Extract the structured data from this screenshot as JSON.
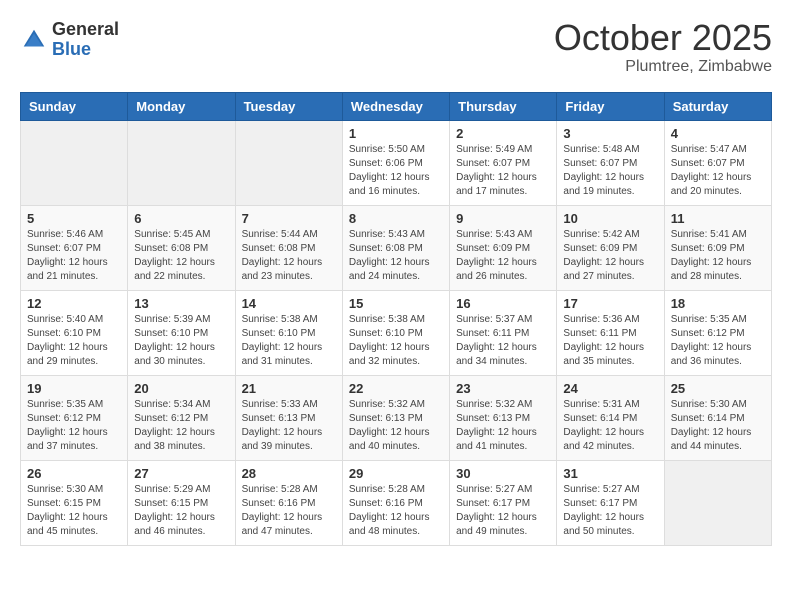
{
  "header": {
    "logo_general": "General",
    "logo_blue": "Blue",
    "month": "October 2025",
    "location": "Plumtree, Zimbabwe"
  },
  "days_of_week": [
    "Sunday",
    "Monday",
    "Tuesday",
    "Wednesday",
    "Thursday",
    "Friday",
    "Saturday"
  ],
  "weeks": [
    [
      {
        "day": "",
        "content": ""
      },
      {
        "day": "",
        "content": ""
      },
      {
        "day": "",
        "content": ""
      },
      {
        "day": "1",
        "content": "Sunrise: 5:50 AM\nSunset: 6:06 PM\nDaylight: 12 hours and 16 minutes."
      },
      {
        "day": "2",
        "content": "Sunrise: 5:49 AM\nSunset: 6:07 PM\nDaylight: 12 hours and 17 minutes."
      },
      {
        "day": "3",
        "content": "Sunrise: 5:48 AM\nSunset: 6:07 PM\nDaylight: 12 hours and 19 minutes."
      },
      {
        "day": "4",
        "content": "Sunrise: 5:47 AM\nSunset: 6:07 PM\nDaylight: 12 hours and 20 minutes."
      }
    ],
    [
      {
        "day": "5",
        "content": "Sunrise: 5:46 AM\nSunset: 6:07 PM\nDaylight: 12 hours and 21 minutes."
      },
      {
        "day": "6",
        "content": "Sunrise: 5:45 AM\nSunset: 6:08 PM\nDaylight: 12 hours and 22 minutes."
      },
      {
        "day": "7",
        "content": "Sunrise: 5:44 AM\nSunset: 6:08 PM\nDaylight: 12 hours and 23 minutes."
      },
      {
        "day": "8",
        "content": "Sunrise: 5:43 AM\nSunset: 6:08 PM\nDaylight: 12 hours and 24 minutes."
      },
      {
        "day": "9",
        "content": "Sunrise: 5:43 AM\nSunset: 6:09 PM\nDaylight: 12 hours and 26 minutes."
      },
      {
        "day": "10",
        "content": "Sunrise: 5:42 AM\nSunset: 6:09 PM\nDaylight: 12 hours and 27 minutes."
      },
      {
        "day": "11",
        "content": "Sunrise: 5:41 AM\nSunset: 6:09 PM\nDaylight: 12 hours and 28 minutes."
      }
    ],
    [
      {
        "day": "12",
        "content": "Sunrise: 5:40 AM\nSunset: 6:10 PM\nDaylight: 12 hours and 29 minutes."
      },
      {
        "day": "13",
        "content": "Sunrise: 5:39 AM\nSunset: 6:10 PM\nDaylight: 12 hours and 30 minutes."
      },
      {
        "day": "14",
        "content": "Sunrise: 5:38 AM\nSunset: 6:10 PM\nDaylight: 12 hours and 31 minutes."
      },
      {
        "day": "15",
        "content": "Sunrise: 5:38 AM\nSunset: 6:10 PM\nDaylight: 12 hours and 32 minutes."
      },
      {
        "day": "16",
        "content": "Sunrise: 5:37 AM\nSunset: 6:11 PM\nDaylight: 12 hours and 34 minutes."
      },
      {
        "day": "17",
        "content": "Sunrise: 5:36 AM\nSunset: 6:11 PM\nDaylight: 12 hours and 35 minutes."
      },
      {
        "day": "18",
        "content": "Sunrise: 5:35 AM\nSunset: 6:12 PM\nDaylight: 12 hours and 36 minutes."
      }
    ],
    [
      {
        "day": "19",
        "content": "Sunrise: 5:35 AM\nSunset: 6:12 PM\nDaylight: 12 hours and 37 minutes."
      },
      {
        "day": "20",
        "content": "Sunrise: 5:34 AM\nSunset: 6:12 PM\nDaylight: 12 hours and 38 minutes."
      },
      {
        "day": "21",
        "content": "Sunrise: 5:33 AM\nSunset: 6:13 PM\nDaylight: 12 hours and 39 minutes."
      },
      {
        "day": "22",
        "content": "Sunrise: 5:32 AM\nSunset: 6:13 PM\nDaylight: 12 hours and 40 minutes."
      },
      {
        "day": "23",
        "content": "Sunrise: 5:32 AM\nSunset: 6:13 PM\nDaylight: 12 hours and 41 minutes."
      },
      {
        "day": "24",
        "content": "Sunrise: 5:31 AM\nSunset: 6:14 PM\nDaylight: 12 hours and 42 minutes."
      },
      {
        "day": "25",
        "content": "Sunrise: 5:30 AM\nSunset: 6:14 PM\nDaylight: 12 hours and 44 minutes."
      }
    ],
    [
      {
        "day": "26",
        "content": "Sunrise: 5:30 AM\nSunset: 6:15 PM\nDaylight: 12 hours and 45 minutes."
      },
      {
        "day": "27",
        "content": "Sunrise: 5:29 AM\nSunset: 6:15 PM\nDaylight: 12 hours and 46 minutes."
      },
      {
        "day": "28",
        "content": "Sunrise: 5:28 AM\nSunset: 6:16 PM\nDaylight: 12 hours and 47 minutes."
      },
      {
        "day": "29",
        "content": "Sunrise: 5:28 AM\nSunset: 6:16 PM\nDaylight: 12 hours and 48 minutes."
      },
      {
        "day": "30",
        "content": "Sunrise: 5:27 AM\nSunset: 6:17 PM\nDaylight: 12 hours and 49 minutes."
      },
      {
        "day": "31",
        "content": "Sunrise: 5:27 AM\nSunset: 6:17 PM\nDaylight: 12 hours and 50 minutes."
      },
      {
        "day": "",
        "content": ""
      }
    ]
  ]
}
